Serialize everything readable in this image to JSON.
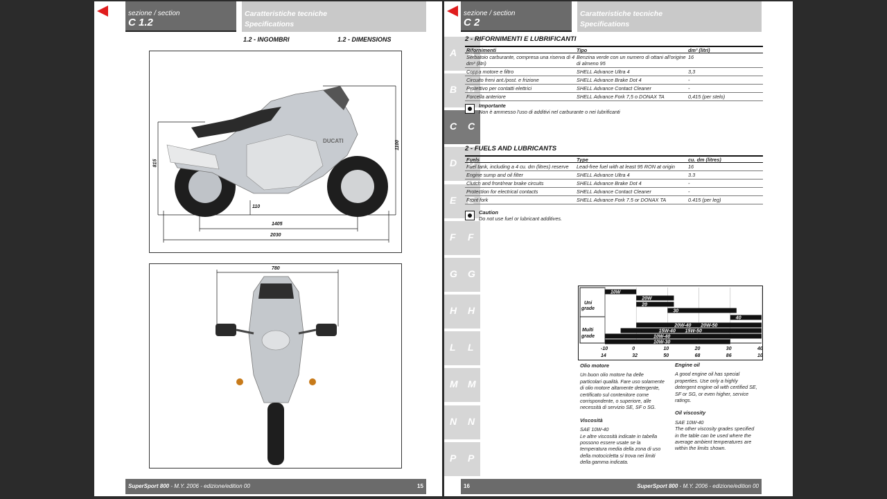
{
  "left_page": {
    "section_label": "sezione / section",
    "section_code": "C 1.2",
    "title_line1": "Caratteristiche tecniche",
    "title_line2": "Specifications",
    "sub_it": "1.2 - INGOMBRI",
    "sub_en": "1.2 - DIMENSIONS",
    "dims": {
      "height_seat": "815",
      "height_total": "1100",
      "ground": "110",
      "wheelbase": "1405",
      "length": "2030",
      "width": "780"
    },
    "footer_model": "SuperSport 800",
    "footer_rest": " - M.Y. 2006 - edizione/edition 00",
    "page_number": "15"
  },
  "tabs": [
    {
      "letter": "A"
    },
    {
      "letter": "B"
    },
    {
      "letter": "C"
    },
    {
      "letter": "D"
    },
    {
      "letter": "E"
    },
    {
      "letter": "F"
    },
    {
      "letter": "G"
    },
    {
      "letter": "H"
    },
    {
      "letter": "L"
    },
    {
      "letter": "M"
    },
    {
      "letter": "N"
    },
    {
      "letter": "P"
    }
  ],
  "active_tab": "C",
  "right_page": {
    "section_label": "sezione / section",
    "section_code": "C 2",
    "title_line1": "Caratteristiche tecniche",
    "title_line2": "Specifications",
    "it_title": "2 - RIFORNIMENTI E LUBRIFICANTI",
    "it_headers": [
      "Rifornimenti",
      "Tipo",
      "dm³ (litri)"
    ],
    "it_rows": [
      [
        "Serbatoio carburante, compresa una riserva di 4 dm³ (litri)",
        "Benzina verde con un numero di ottani all'origine di almeno 95",
        "16"
      ],
      [
        "Coppa motore e filtro",
        "SHELL Advance Ultra 4",
        "3,3"
      ],
      [
        "Circuito freni ant./post. e frizione",
        "SHELL Advance Brake Dot 4",
        "-"
      ],
      [
        "Protettivo per contatti elettrici",
        "SHELL Advance Contact Cleaner",
        "-"
      ],
      [
        "Forcella anteriore",
        "SHELL Advance Fork 7,5 o DONAX TA",
        "0,415 (per stelo)"
      ]
    ],
    "it_note_title": "Importante",
    "it_note_body": "Non è ammesso l'uso di additivi nel carburante o nei lubrificanti",
    "en_title": "2 - FUELS AND LUBRICANTS",
    "en_headers": [
      "Fuels",
      "Type",
      "cu. dm (litres)"
    ],
    "en_rows": [
      [
        "Fuel tank, including a 4 cu. dm (litres) reserve",
        "Lead-free fuel with at least 95 RON at origin",
        "16"
      ],
      [
        "Engine sump and oil filter",
        "SHELL Advance Ultra 4",
        "3.3"
      ],
      [
        "Clutch and front/rear brake circuits",
        "SHELL Advance Brake Dot 4",
        "-"
      ],
      [
        "Protection for electrical contacts",
        "SHELL Advance Contact Cleaner",
        "-"
      ],
      [
        "Front fork",
        "SHELL Advance Fork 7.5 or DONAX TA",
        "0.415 (per leg)"
      ]
    ],
    "en_note_title": "Caution",
    "en_note_body": "Do not use fuel or lubricant additives.",
    "chart": {
      "uni_label": [
        "Uni",
        "grade"
      ],
      "multi_label": [
        "Multi",
        "grade"
      ],
      "c_ticks": [
        "-10",
        "0",
        "10",
        "20",
        "30",
        "40 C"
      ],
      "f_ticks": [
        "14",
        "32",
        "50",
        "68",
        "86",
        "104 F"
      ]
    },
    "oil_it_title": "Olio motore",
    "oil_it_body": [
      "Un buon olio motore ha delle",
      "particolari qualità. Fare uso solamente",
      "di olio motore altamente detergente,",
      "certificato sul contenitore come",
      "corrispondente, o superiore, alle",
      "necessità di servizio SE, SF o SG."
    ],
    "visc_it_title": "Viscosità",
    "visc_it_body": [
      "SAE 10W-40",
      "Le altre viscosità indicate in tabella",
      "possono essere usate se la",
      "temperatura media della zona di uso",
      "della motocicletta si trova nei limiti",
      "della gamma indicata."
    ],
    "oil_en_title": "Engine oil",
    "oil_en_body": [
      "A good engine oil has special",
      "properties. Use only a highly",
      "detergent engine oil with certified SE,",
      "SF or SG, or even higher, service",
      "ratings."
    ],
    "visc_en_title": "Oil viscosity",
    "visc_en_body": [
      "SAE 10W-40",
      "The other viscosity grades specified",
      "in the table can be used where the",
      "average ambient temperatures are",
      "within the limits shown."
    ],
    "page_number": "16",
    "footer_model": "SuperSport 800",
    "footer_rest": " - M.Y. 2006 - edizione/edition 00"
  },
  "chart_data": {
    "type": "bar",
    "title": "",
    "x_unit": "°C",
    "xlim": [
      -10,
      40
    ],
    "series": [
      {
        "name": "10W",
        "grade": "uni",
        "x_range": [
          -10,
          0
        ]
      },
      {
        "name": "20W",
        "grade": "uni",
        "x_range": [
          0,
          12
        ]
      },
      {
        "name": "20",
        "grade": "uni",
        "x_range": [
          0,
          12
        ]
      },
      {
        "name": "30",
        "grade": "uni",
        "x_range": [
          10,
          32
        ]
      },
      {
        "name": "40",
        "grade": "uni",
        "x_range": [
          30,
          40
        ]
      },
      {
        "name": "20W-40",
        "grade": "multi",
        "x_range": [
          0,
          40
        ]
      },
      {
        "name": "20W-50",
        "grade": "multi",
        "x_range": [
          0,
          40
        ]
      },
      {
        "name": "15W-40",
        "grade": "multi",
        "x_range": [
          -5,
          40
        ]
      },
      {
        "name": "15W-50",
        "grade": "multi",
        "x_range": [
          -5,
          40
        ]
      },
      {
        "name": "10W-40",
        "grade": "multi",
        "x_range": [
          -10,
          40
        ]
      },
      {
        "name": "10W-30",
        "grade": "multi",
        "x_range": [
          -10,
          30
        ]
      }
    ]
  }
}
